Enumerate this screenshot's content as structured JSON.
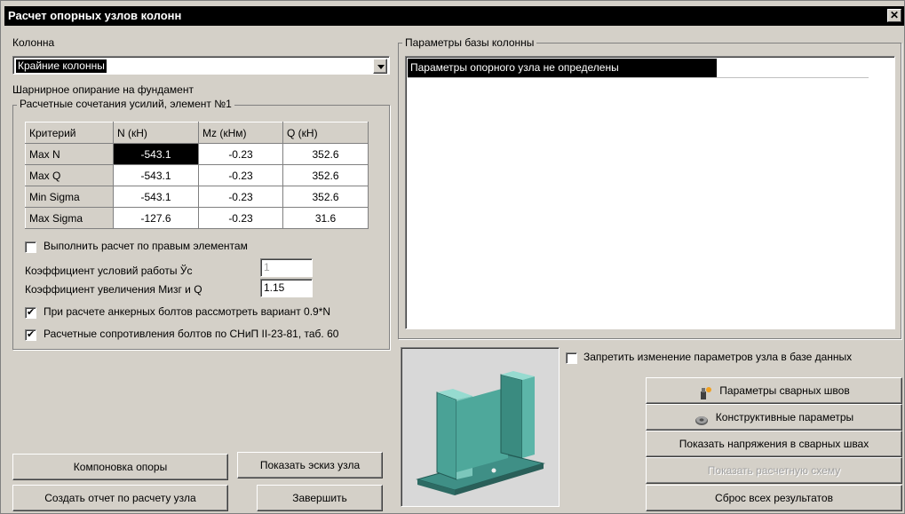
{
  "window": {
    "title": "Расчет опорных узлов колонн"
  },
  "column": {
    "label": "Колонна",
    "selected": "Крайние колонны",
    "support_note": "Шарнирное опирание на фундамент"
  },
  "forces": {
    "group_title": "Расчетные сочетания усилий, элемент №1",
    "headers": [
      "Критерий",
      "N (кН)",
      "Mz (кНм)",
      "Q (кН)"
    ],
    "rows": [
      [
        "Max N",
        "-543.1",
        "-0.23",
        "352.6"
      ],
      [
        "Max Q",
        "-543.1",
        "-0.23",
        "352.6"
      ],
      [
        "Min Sigma",
        "-543.1",
        "-0.23",
        "352.6"
      ],
      [
        "Max Sigma",
        "-127.6",
        "-0.23",
        "31.6"
      ]
    ]
  },
  "options": {
    "right_elements": {
      "label": "Выполнить расчет по правым элементам",
      "checked": false
    },
    "gamma_c": {
      "label": "Коэффициент условий работы Ўс",
      "value": "1"
    },
    "increase": {
      "label": "Коэффициент увеличения  Мизг и Q",
      "value": "1.15"
    },
    "anchor_09n": {
      "label": "При расчете анкерных болтов рассмотреть вариант 0.9*N",
      "checked": true
    },
    "bolt_resistance": {
      "label": "Расчетные сопротивления болтов по СНиП II-23-81, таб. 60",
      "checked": true
    }
  },
  "base_params": {
    "group_title": "Параметры базы колонны",
    "items": [
      "Параметры опорного узла не определены"
    ]
  },
  "lock": {
    "label": "Запретить изменение параметров узла в базе данных",
    "checked": false
  },
  "buttons": {
    "layout": "Компоновка опоры",
    "show_sketch": "Показать эскиз узла",
    "create_report": "Создать отчет по расчету узла",
    "finish": "Завершить",
    "weld_params": "Параметры сварных швов",
    "design_params": "Конструктивные параметры",
    "show_weld_stress": "Показать напряжения в сварных швах",
    "show_scheme": "Показать расчетную схему",
    "reset": "Сброс всех результатов"
  },
  "icons": {
    "weld": "weld-torch-icon",
    "gear": "gear-icon",
    "close": "close-icon",
    "dropdown": "chevron-down-icon"
  },
  "colors": {
    "face": "#d4d0c8",
    "selection": "#000000",
    "model": "#3f8f86"
  }
}
